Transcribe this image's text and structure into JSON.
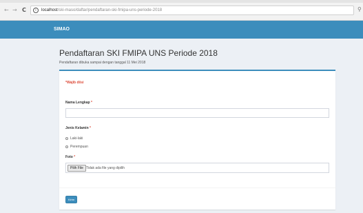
{
  "browser": {
    "back_icon": "arrow-left-icon",
    "forward_icon": "arrow-right-icon",
    "reload_icon": "reload-icon",
    "url_host": "localhost",
    "url_path": "/ski-maso/daftar/pendaftaran-ski-fmipa-uns-periode-2018",
    "search_icon": "search-icon"
  },
  "topnav": {
    "brand": "SIMAO",
    "color": "#3c8dbc"
  },
  "page": {
    "title": "Pendaftaran SKI FMIPA UNS Periode 2018",
    "subtitle": "Pendaftaran dibuka sampai dengan tanggal 11 Mei 2018"
  },
  "form": {
    "required_note": "Wajib diisi",
    "name_label": "Nama Lengkap",
    "name_value": "",
    "gender_label": "Jenis Kelamin",
    "gender_options": [
      "Laki-laki",
      "Perempuan"
    ],
    "photo_label": "Foto",
    "file_button": "Pilih File",
    "file_status": "Tidak ada file yang dipilih",
    "submit_label": "Kirim",
    "required_marker": "*",
    "accent_color": "#dd4b39"
  }
}
